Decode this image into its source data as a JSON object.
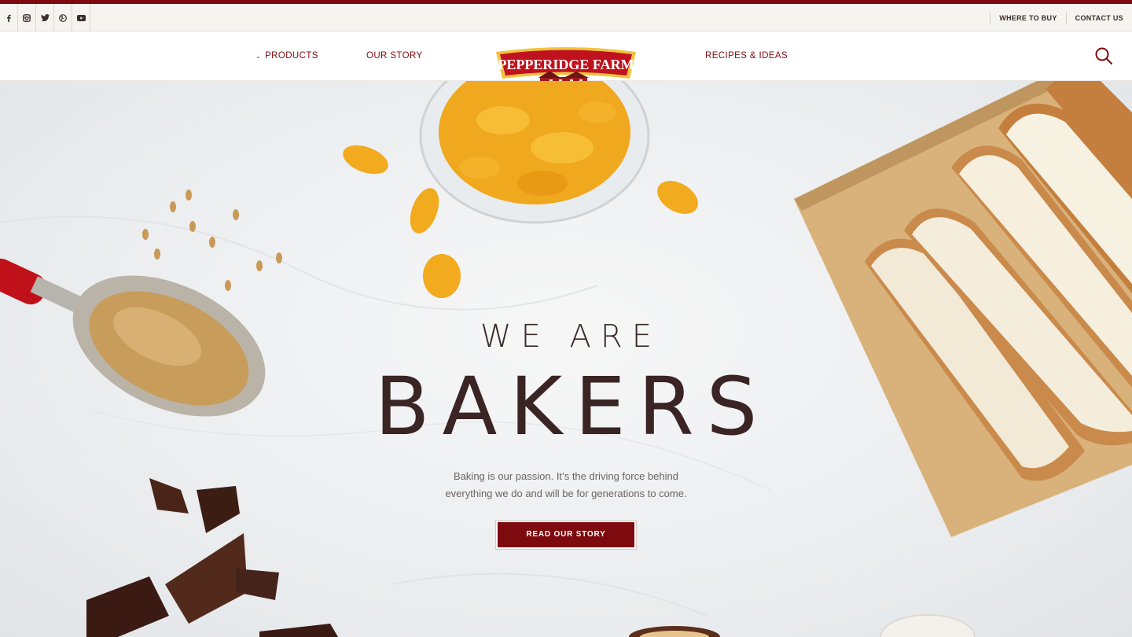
{
  "colors": {
    "brand": "#7d0a0e",
    "utility_bg": "#f6f4ef",
    "hero_text": "#3a2424"
  },
  "social": [
    {
      "icon": "facebook-icon",
      "glyph": "f"
    },
    {
      "icon": "instagram-icon",
      "glyph": "ig"
    },
    {
      "icon": "twitter-icon",
      "glyph": "tw"
    },
    {
      "icon": "pinterest-icon",
      "glyph": "p"
    },
    {
      "icon": "youtube-icon",
      "glyph": "yt"
    }
  ],
  "utility": {
    "where_to_buy": "WHERE TO BUY",
    "contact_us": "CONTACT US"
  },
  "nav": {
    "products": "PRODUCTS",
    "our_story": "OUR STORY",
    "recipes": "RECIPES & IDEAS",
    "logo_text": "PEPPERIDGE FARM",
    "search_icon": "search-icon"
  },
  "hero": {
    "sub": "WE ARE",
    "title": "BAKERS",
    "text": "Baking is our passion. It’s the driving force behind everything we do and will be for generations to come.",
    "cta": "READ OUR STORY"
  }
}
